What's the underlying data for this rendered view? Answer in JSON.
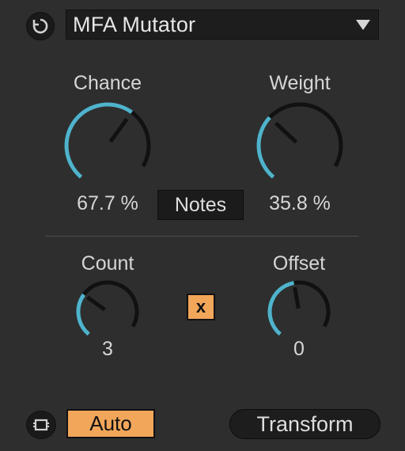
{
  "header": {
    "preset_name": "MFA Mutator"
  },
  "knobs": [
    {
      "id": "chance",
      "label": "Chance",
      "value": "67.7 %",
      "fraction": 0.677
    },
    {
      "id": "weight",
      "label": "Weight",
      "value": "35.8 %",
      "fraction": 0.358
    },
    {
      "id": "count",
      "label": "Count",
      "value": "3",
      "fraction": 0.33
    },
    {
      "id": "offset",
      "label": "Offset",
      "value": "0",
      "fraction": 0.5
    }
  ],
  "buttons": {
    "notes": "Notes",
    "x_toggle": "x",
    "auto": "Auto",
    "transform": "Transform"
  },
  "colors": {
    "accent": "#4fb3cc",
    "track": "#111111",
    "toggle_on": "#f2a65a",
    "background": "#2e2e2e"
  }
}
